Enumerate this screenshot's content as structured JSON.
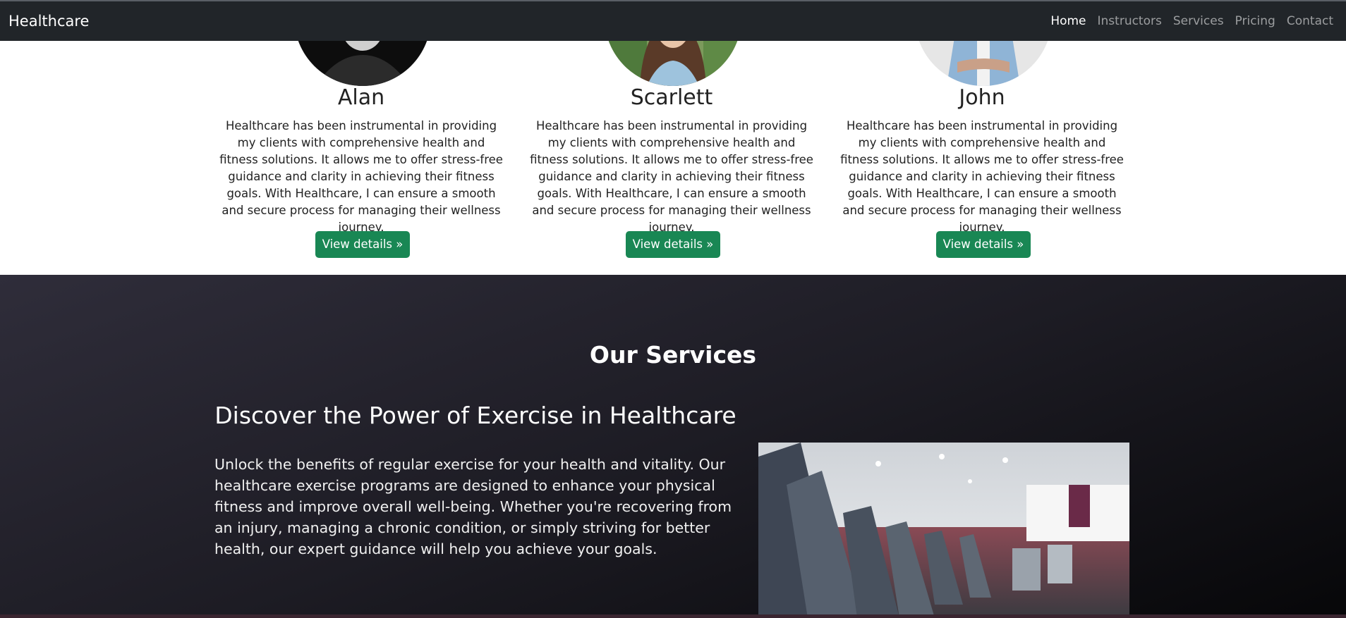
{
  "nav": {
    "brand": "Healthcare",
    "links": [
      {
        "label": "Home",
        "active": true
      },
      {
        "label": "Instructors",
        "active": false
      },
      {
        "label": "Services",
        "active": false
      },
      {
        "label": "Pricing",
        "active": false
      },
      {
        "label": "Contact",
        "active": false
      }
    ]
  },
  "instructors": [
    {
      "name": "Alan",
      "description": "Healthcare has been instrumental in providing my clients with comprehensive health and fitness solutions. It allows me to offer stress-free guidance and clarity in achieving their fitness goals. With Healthcare, I can ensure a smooth and secure process for managing their wellness journey.",
      "button": "View details »"
    },
    {
      "name": "Scarlett",
      "description": "Healthcare has been instrumental in providing my clients with comprehensive health and fitness solutions. It allows me to offer stress-free guidance and clarity in achieving their fitness goals. With Healthcare, I can ensure a smooth and secure process for managing their wellness journey.",
      "button": "View details »"
    },
    {
      "name": "John",
      "description": "Healthcare has been instrumental in providing my clients with comprehensive health and fitness solutions. It allows me to offer stress-free guidance and clarity in achieving their fitness goals. With Healthcare, I can ensure a smooth and secure process for managing their wellness journey.",
      "button": "View details »"
    }
  ],
  "services": {
    "title": "Our Services",
    "heading": "Discover the Power of Exercise in Healthcare",
    "body": "Unlock the benefits of regular exercise for your health and vitality. Our healthcare exercise programs are designed to enhance your physical fitness and improve overall well-being. Whether you're recovering from an injury, managing a chronic condition, or simply striving for better health, our expert guidance will help you achieve your goals."
  },
  "colors": {
    "navbar": "#212529",
    "button": "#198754",
    "services_bg": "#1d1c24"
  }
}
